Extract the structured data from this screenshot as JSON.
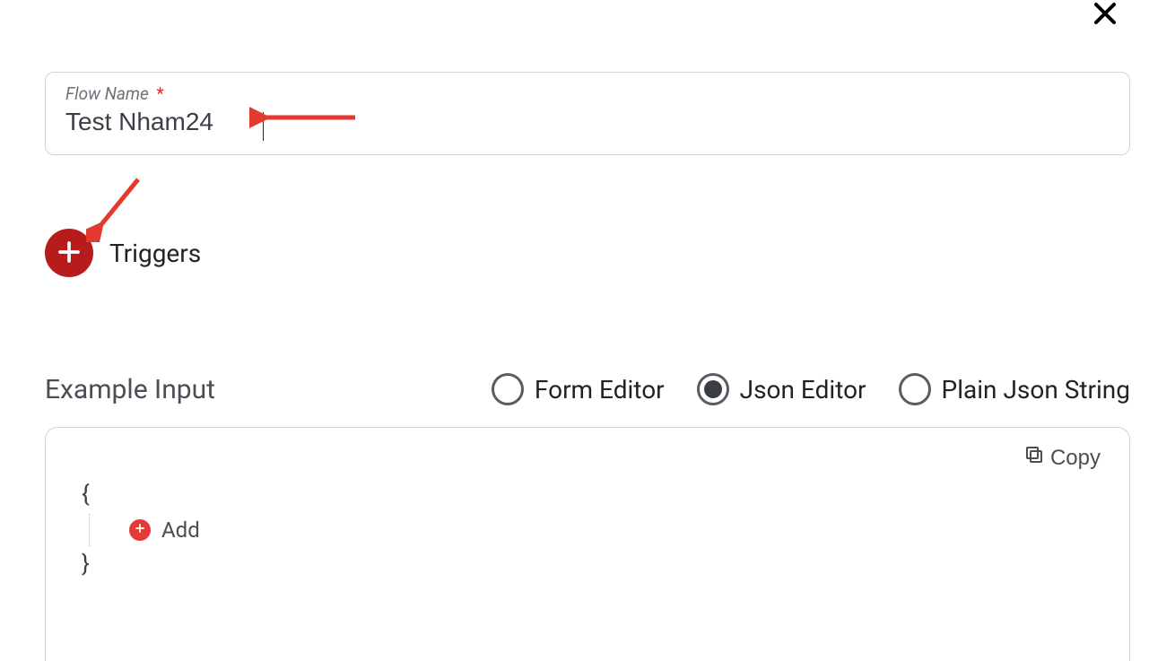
{
  "close": {
    "name": "close"
  },
  "flow_name_field": {
    "label": "Flow Name",
    "required_mark": "*",
    "value": "Test Nham24"
  },
  "triggers": {
    "label": "Triggers"
  },
  "example_input": {
    "title": "Example Input",
    "radios": {
      "form": {
        "label": "Form Editor",
        "selected": false
      },
      "json": {
        "label": "Json Editor",
        "selected": true
      },
      "plain": {
        "label": "Plain Json String",
        "selected": false
      }
    },
    "copy_label": "Copy",
    "editor": {
      "open_brace": "{",
      "close_brace": "}",
      "add_label": "Add"
    }
  },
  "colors": {
    "brand_red": "#b71c1c",
    "accent_red": "#e53935",
    "border_gray": "#d0d3d6",
    "text_muted": "#6e7178"
  }
}
